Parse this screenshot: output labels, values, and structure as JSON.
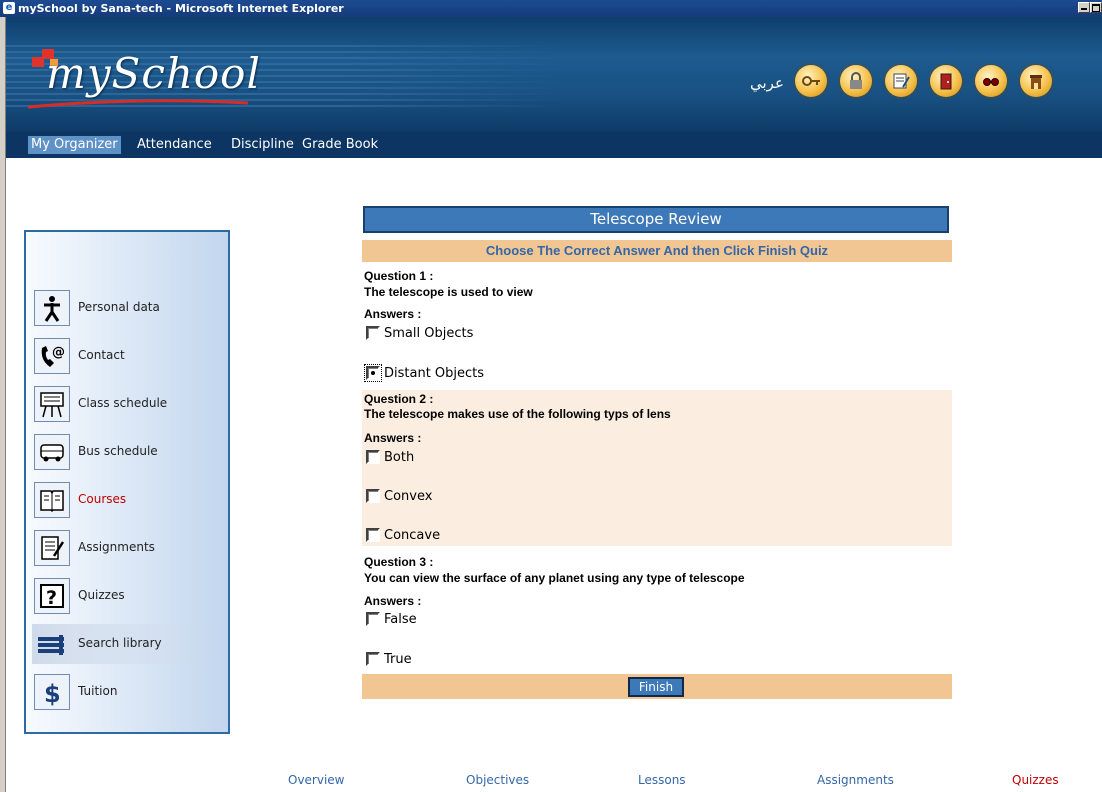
{
  "window": {
    "title": "mySchool by Sana-tech - Microsoft Internet Explorer"
  },
  "header": {
    "logo_text": "mySchool",
    "language_link": "عربي",
    "icons": [
      "key-icon",
      "lock-icon",
      "notepad-icon",
      "door-exit-icon",
      "glasses-icon",
      "building-icon"
    ]
  },
  "nav": {
    "items": [
      "My Organizer",
      "Attendance",
      "Discipline",
      "Grade Book"
    ],
    "active": "My Organizer"
  },
  "sidebar": {
    "items": [
      {
        "label": "Personal data",
        "icon": "person-icon"
      },
      {
        "label": "Contact",
        "icon": "phone-at-icon"
      },
      {
        "label": "Class schedule",
        "icon": "easel-icon"
      },
      {
        "label": "Bus schedule",
        "icon": "bus-icon"
      },
      {
        "label": "Courses",
        "icon": "book-icon",
        "active": true
      },
      {
        "label": "Assignments",
        "icon": "document-icon"
      },
      {
        "label": "Quizzes",
        "icon": "question-icon"
      },
      {
        "label": "Search library",
        "icon": "books-icon"
      },
      {
        "label": "Tuition",
        "icon": "dollar-icon"
      }
    ]
  },
  "quiz": {
    "title": "Telescope Review",
    "instruction": "Choose The Correct Answer And then Click Finish Quiz",
    "answers_label": "Answers :",
    "questions": [
      {
        "label": "Question 1 :",
        "text": "The telescope is used to view",
        "options": [
          "Small Objects",
          "Distant Objects"
        ],
        "selected": 1
      },
      {
        "label": "Question 2 :",
        "text": "The telescope makes use of the following typs of lens",
        "options": [
          "Both",
          "Convex",
          "Concave"
        ],
        "selected": null
      },
      {
        "label": "Question 3 :",
        "text": "You can view the surface of any planet using any type of telescope",
        "options": [
          "False",
          "True"
        ],
        "selected": null
      }
    ],
    "finish_label": "Finish"
  },
  "footer": {
    "links": [
      "Overview",
      "Objectives",
      "Lessons",
      "Assignments",
      "Quizzes"
    ],
    "active": "Quizzes"
  },
  "colors": {
    "accent": "#3d78b8",
    "nav_dark": "#0c3563",
    "highlight_bar": "#f1c693",
    "active_link": "#c00000"
  }
}
